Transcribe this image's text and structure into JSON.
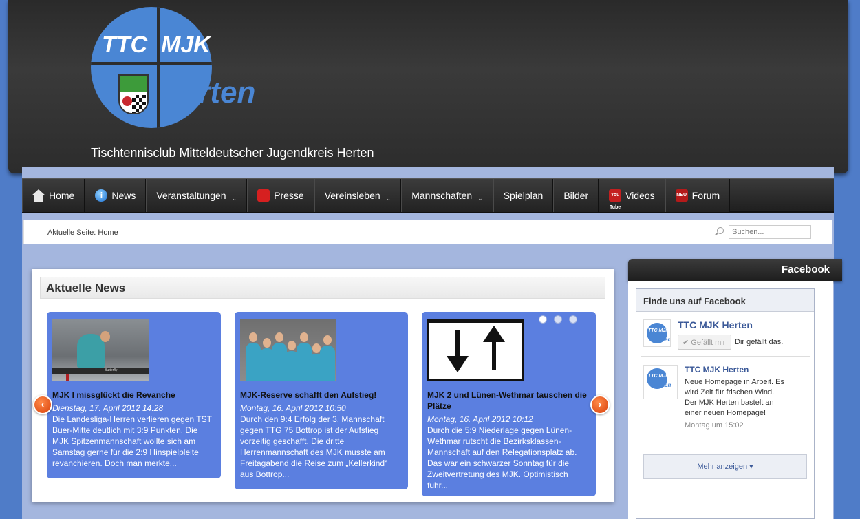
{
  "logo": {
    "line1_left": "TTC",
    "line1_right": "MJK",
    "line2": "Herten"
  },
  "site": {
    "subtitle": "Tischtennisclub Mitteldeutscher Jugendkreis Herten"
  },
  "nav": {
    "items": [
      {
        "label": "Home",
        "icon": "home-icon"
      },
      {
        "label": "News",
        "icon": "info-icon"
      },
      {
        "label": "Veranstaltungen",
        "dropdown": true
      },
      {
        "label": "Presse",
        "icon": "pdf-icon"
      },
      {
        "label": "Vereinsleben",
        "dropdown": true
      },
      {
        "label": "Mannschaften",
        "dropdown": true
      },
      {
        "label": "Spielplan"
      },
      {
        "label": "Bilder"
      },
      {
        "label": "Videos",
        "icon": "youtube-icon",
        "icon_text": "You Tube"
      },
      {
        "label": "Forum",
        "icon": "new-badge-icon",
        "icon_text": "NEU"
      }
    ]
  },
  "breadcrumb": {
    "text": "Aktuelle Seite: Home"
  },
  "search": {
    "placeholder": "Suchen..."
  },
  "news": {
    "title": "Aktuelle News",
    "items": [
      {
        "title": "MJK I missglückt die Revanche",
        "date": "Dienstag, 17. April 2012 14:28",
        "text": "Die Landesliga-Herren verlieren gegen TST Buer-Mitte deutlich mit 3:9 Punkten. Die MJK Spitzenmannschaft wollte sich am Samstag gerne für die 2:9 Hinspielpleite revanchieren. Doch man merkte..."
      },
      {
        "title": "MJK-Reserve schafft den Aufstieg!",
        "date": "Montag, 16. April 2012 10:50",
        "text": "Durch den 9:4 Erfolg der 3. Mannschaft gegen TTG 75 Bottrop ist der Aufstieg vorzeitig geschafft. Die dritte Herrenmannschaft des MJK musste am Freitagabend die Reise zum „Kellerkind“ aus Bottrop..."
      },
      {
        "title": "MJK 2 und Lünen-Wethmar tauschen die Plätze",
        "date": "Montag, 16. April 2012 10:12",
        "text": "Durch die 5:9 Niederlage gegen Lünen-Wethmar rutscht die Bezirksklassen-Mannschaft auf den Relegationsplatz ab. Das war ein schwarzer Sonntag für die Zweitvertretung des MJK. Optimistisch fuhr..."
      }
    ],
    "thumb1_sign": "Butterfly",
    "prev_label": "‹",
    "next_label": "›"
  },
  "facebook": {
    "tab_label": "Facebook",
    "box_title": "Finde uns auf Facebook",
    "page_name": "TTC MJK Herten",
    "like_button": "✔ Gefällt mir",
    "like_text": "Dir gefällt das.",
    "post": {
      "author": "TTC MJK Herten",
      "text": "Neue Homepage in Arbeit. Es wird Zeit für frischen Wind. Der MJK Herten bastelt an einer neuen Homepage!",
      "time": "Montag um 15:02"
    },
    "more": "Mehr anzeigen ▾"
  },
  "avatar": {
    "top": "TTC MJK",
    "bottom": "Herten"
  },
  "colors": {
    "page_bg": "#4f7cc8",
    "header_bg": "#2c2c2c",
    "card_bg": "#5b7fe0",
    "accent_orange": "#d8400a",
    "fb_blue": "#3b5998"
  }
}
